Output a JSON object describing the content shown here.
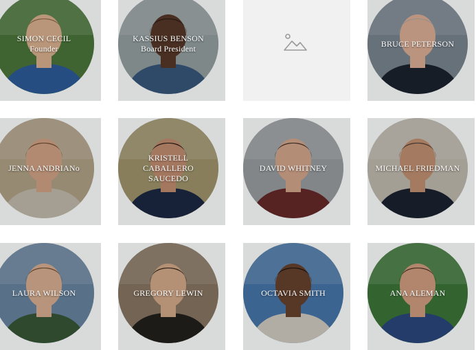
{
  "people": [
    {
      "name": "SIMON CECIL",
      "role": "Founder",
      "bg": "#4d7a3c",
      "skin": "#e2b894",
      "hair": "#8c6b45",
      "shirt": "#2f5f9e"
    },
    {
      "name": "KASSIUS BENSON",
      "role": "Board President",
      "bg": "#9aa6a8",
      "skin": "#5a3a2a",
      "hair": "#2a1e18",
      "shirt": "#3a5a80"
    },
    {
      "name": "",
      "role": "",
      "bg": "",
      "skin": "",
      "hair": "",
      "shirt": ""
    },
    {
      "name": "BRUCE PETERSON",
      "role": "",
      "bg": "#7e8a95",
      "skin": "#e3b59a",
      "hair": "#b8b0a6",
      "shirt": "#1d2430"
    },
    {
      "name": "JENNA ANDRIANo",
      "role": "",
      "bg": "#b9a98c",
      "skin": "#d9a98a",
      "hair": "#6b4a2e",
      "shirt": "#c9c3b3"
    },
    {
      "name": "KRISTELL CABALLERO SAUCEDO",
      "role": "",
      "bg": "#a79a6f",
      "skin": "#c89275",
      "hair": "#1e1510",
      "shirt": "#1d2a45"
    },
    {
      "name": "DAVID  WHITNEY",
      "role": "",
      "bg": "#9fa4a8",
      "skin": "#dcad92",
      "hair": "#3b2a20",
      "shirt": "#6a2a2a"
    },
    {
      "name": "MICHAEL FRIEDMAN",
      "role": "",
      "bg": "#c8c2b5",
      "skin": "#c89777",
      "hair": "#4a3a30",
      "shirt": "#1c2432"
    },
    {
      "name": "LAURA WILSON",
      "role": "",
      "bg": "#6d8aa6",
      "skin": "#e0b597",
      "hair": "#6a4a2a",
      "shirt": "#3a5a3a"
    },
    {
      "name": "GREGORY LEWIN",
      "role": "",
      "bg": "#8e7a66",
      "skin": "#dcb08f",
      "hair": "#2a1f18",
      "shirt": "#24221e"
    },
    {
      "name": "OCTAVIA SMITH",
      "role": "",
      "bg": "#4a7bb0",
      "skin": "#6b4530",
      "hair": "#1a120e",
      "shirt": "#d9d4c8"
    },
    {
      "name": "ANA ALEMAN",
      "role": "",
      "bg": "#3f7a3a",
      "skin": "#d8a485",
      "hair": "#4a2c1f",
      "shirt": "#2c4a80"
    }
  ],
  "placeholder_icon": "image-placeholder-icon"
}
